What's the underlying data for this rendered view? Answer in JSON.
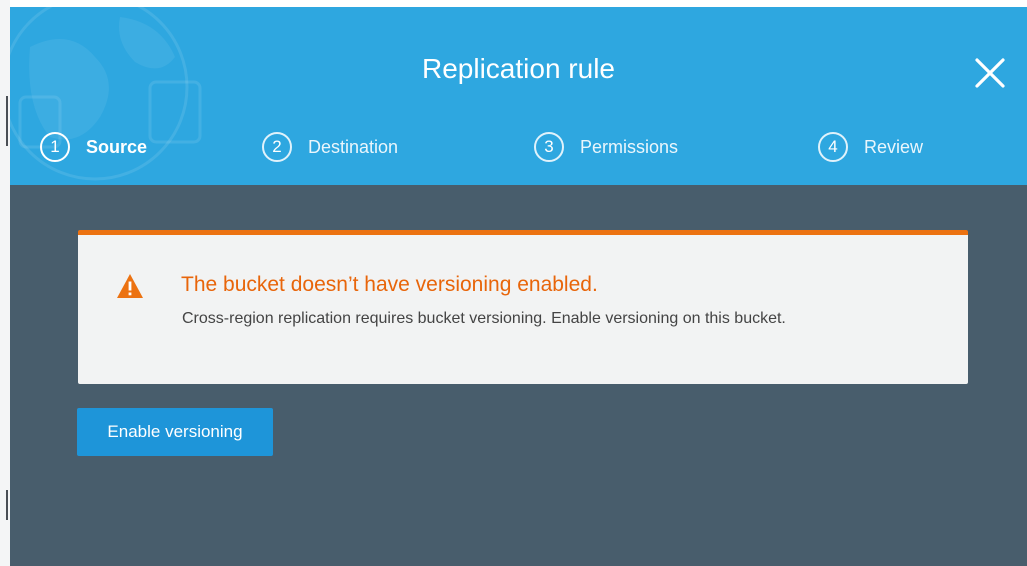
{
  "modal": {
    "title": "Replication rule",
    "close_icon": "close-icon"
  },
  "steps": [
    {
      "number": "1",
      "label": "Source",
      "active": true
    },
    {
      "number": "2",
      "label": "Destination",
      "active": false
    },
    {
      "number": "3",
      "label": "Permissions",
      "active": false
    },
    {
      "number": "4",
      "label": "Review",
      "active": false
    }
  ],
  "alert": {
    "icon": "warning-icon",
    "heading": "The bucket doesn’t have versioning enabled.",
    "message": "Cross-region replication requires bucket versioning. Enable versioning on this bucket."
  },
  "actions": {
    "enable_versioning_label": "Enable versioning"
  },
  "colors": {
    "header": "#2ea7e0",
    "body": "#485d6c",
    "alert_accent": "#ec7211",
    "button": "#1e95d9"
  }
}
